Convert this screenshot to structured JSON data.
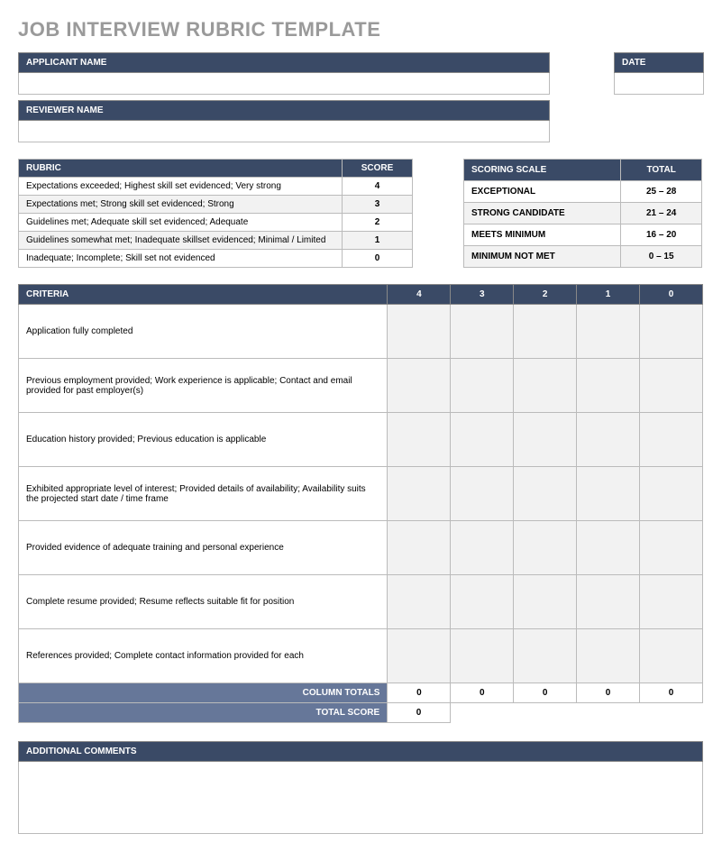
{
  "title": "JOB INTERVIEW RUBRIC TEMPLATE",
  "header": {
    "applicant_label": "APPLICANT NAME",
    "date_label": "DATE",
    "reviewer_label": "REVIEWER NAME"
  },
  "rubric": {
    "header": "RUBRIC",
    "score_header": "SCORE",
    "rows": [
      {
        "desc": "Expectations exceeded; Highest skill set evidenced; Very strong",
        "score": "4"
      },
      {
        "desc": "Expectations met; Strong skill set evidenced; Strong",
        "score": "3"
      },
      {
        "desc": "Guidelines met; Adequate skill set evidenced; Adequate",
        "score": "2"
      },
      {
        "desc": "Guidelines somewhat met; Inadequate skillset evidenced; Minimal / Limited",
        "score": "1"
      },
      {
        "desc": "Inadequate; Incomplete; Skill set not evidenced",
        "score": "0"
      }
    ]
  },
  "scoring": {
    "header": "SCORING SCALE",
    "total_header": "TOTAL",
    "rows": [
      {
        "label": "EXCEPTIONAL",
        "range": "25 – 28"
      },
      {
        "label": "STRONG CANDIDATE",
        "range": "21 – 24"
      },
      {
        "label": "MEETS MINIMUM",
        "range": "16 – 20"
      },
      {
        "label": "MINIMUM NOT MET",
        "range": "0 – 15"
      }
    ]
  },
  "criteria": {
    "header": "CRITERIA",
    "cols": [
      "4",
      "3",
      "2",
      "1",
      "0"
    ],
    "rows": [
      "Application fully completed",
      "Previous employment provided; Work experience is applicable; Contact and email provided for past employer(s)",
      "Education history provided; Previous education is applicable",
      "Exhibited appropriate level of interest; Provided details of availability; Availability suits the projected start date / time frame",
      "Provided evidence of adequate training and personal experience",
      "Complete resume provided; Resume reflects suitable fit for position",
      "References provided; Complete contact information provided for each"
    ],
    "column_totals_label": "COLUMN TOTALS",
    "column_totals": [
      "0",
      "0",
      "0",
      "0",
      "0"
    ],
    "total_score_label": "TOTAL SCORE",
    "total_score": "0"
  },
  "comments": {
    "header": "ADDITIONAL COMMENTS"
  }
}
